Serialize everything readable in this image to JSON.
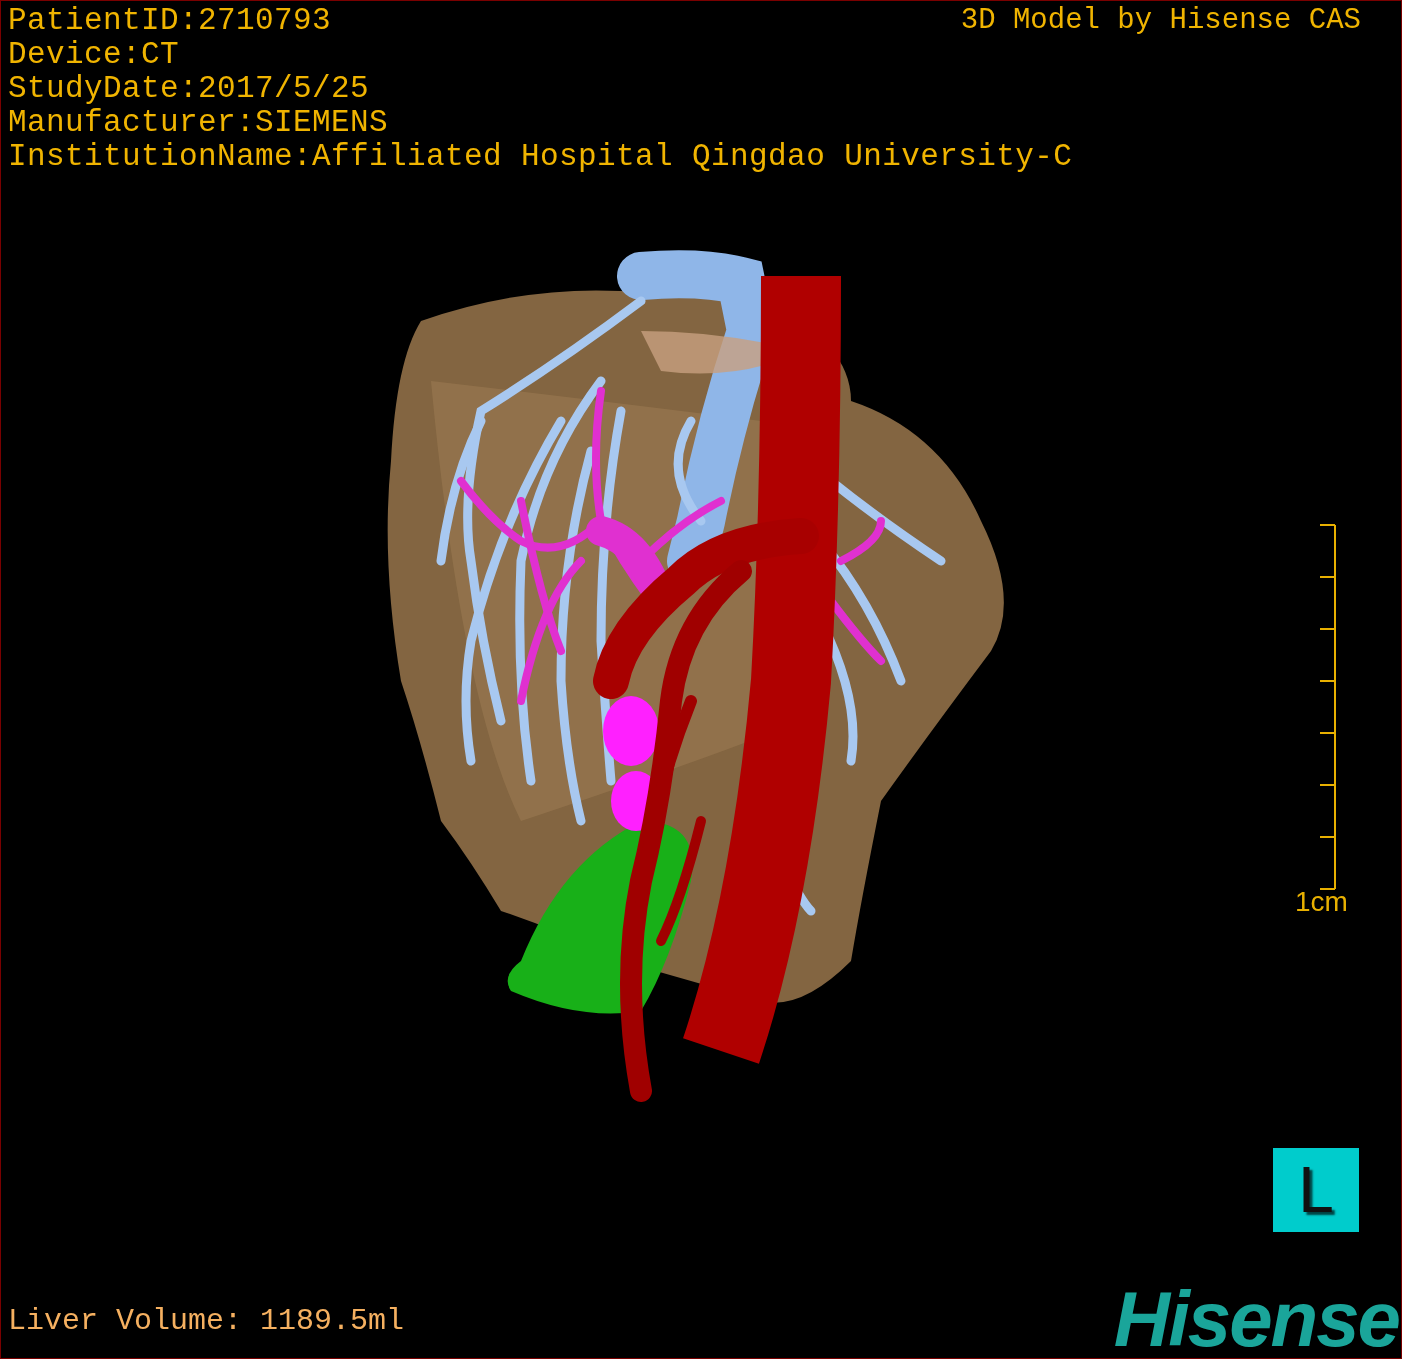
{
  "patient_info": [
    "PatientID:2710793",
    "Device:CT",
    "StudyDate:2017/5/25",
    "Manufacturer:SIEMENS",
    "InstitutionName:Affiliated Hospital Qingdao University-C"
  ],
  "credit": "3D Model by Hisense CAS",
  "scale_bar": {
    "label": "1cm"
  },
  "orientation_marker": "L",
  "liver_volume": "Liver Volume: 1189.5ml",
  "logo": "Hisense"
}
